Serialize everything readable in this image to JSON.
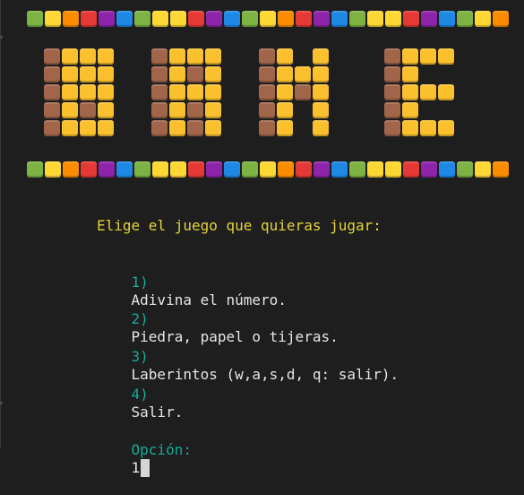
{
  "palette": {
    "green": "#7cb342",
    "yellow": "#fdd835",
    "orange": "#fb8c00",
    "red": "#e53935",
    "purple": "#8e24aa",
    "blue": "#1e88e5",
    "letter_yellow": "#fbc02d",
    "letter_brown": "#a1654a"
  },
  "border_colors": [
    "green",
    "yellow",
    "orange",
    "red",
    "purple",
    "blue",
    "green",
    "yellow",
    "yellow",
    "red",
    "purple",
    "blue",
    "green",
    "yellow",
    "orange",
    "red",
    "purple",
    "blue",
    "green",
    "yellow",
    "yellow",
    "red",
    "purple",
    "blue",
    "green",
    "yellow",
    "orange"
  ],
  "banner": {
    "word": "GAME",
    "letters": [
      {
        "name": "banner-letter-g",
        "rows": [
          "BYYY",
          "BYYY",
          "BYYY",
          "BYBY",
          "BYYY"
        ]
      },
      {
        "name": "banner-letter-a",
        "rows": [
          "BYYY",
          "BYBY",
          "BYYY",
          "BYBY",
          "BYBY"
        ]
      },
      {
        "name": "banner-letter-m",
        "rows": [
          "BY.Y",
          "BYYY",
          "BYBY",
          "BY.Y",
          "BY.Y"
        ]
      },
      {
        "name": "banner-letter-e",
        "rows": [
          "BYYY",
          "BY..",
          "BYYY",
          "BY..",
          "BYYY"
        ]
      }
    ]
  },
  "menu": {
    "title": "Elige el juego que quieras jugar:",
    "options": [
      {
        "num": "1)",
        "label": "Adivina el número."
      },
      {
        "num": "2)",
        "label": "Piedra, papel o tijeras."
      },
      {
        "num": "3)",
        "label": "Laberintos (w,a,s,d, q: salir)."
      },
      {
        "num": "4)",
        "label": "Salir."
      }
    ],
    "prompt_label": "Opción:",
    "input_value": "1"
  }
}
